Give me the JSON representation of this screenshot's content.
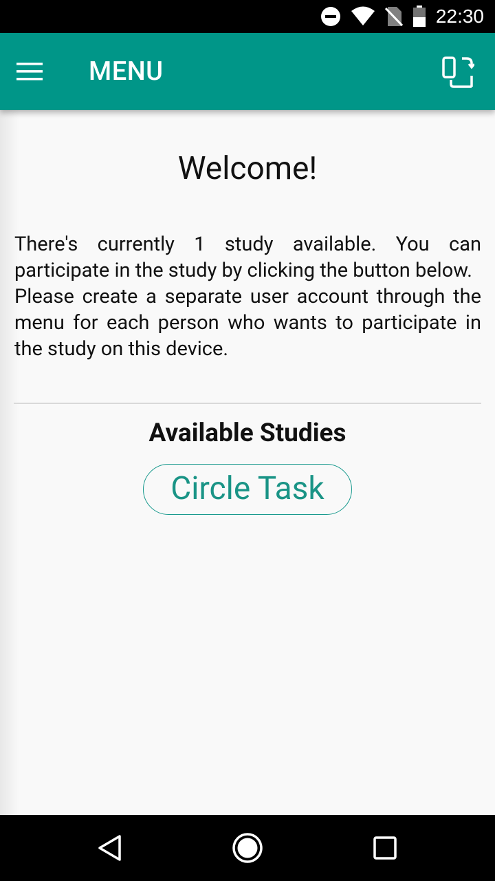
{
  "status_bar": {
    "time": "22:30",
    "icons": [
      "do-not-disturb-icon",
      "wifi-icon",
      "no-sim-icon",
      "battery-icon"
    ]
  },
  "app_bar": {
    "title": "MENU",
    "color": "#009688"
  },
  "main": {
    "welcome": "Welcome!",
    "intro_paragraph_1": "There's currently 1 study available. You can participate in the study by clicking the button below.",
    "intro_paragraph_2": "Please create a separate user account through the menu for each person who wants to participate in the study on this device.",
    "studies_heading": "Available Studies",
    "studies": [
      {
        "label": "Circle Task"
      }
    ],
    "accent": "#1a9486"
  },
  "nav_bar": {
    "icons": [
      "back-icon",
      "home-icon",
      "recents-icon"
    ]
  }
}
